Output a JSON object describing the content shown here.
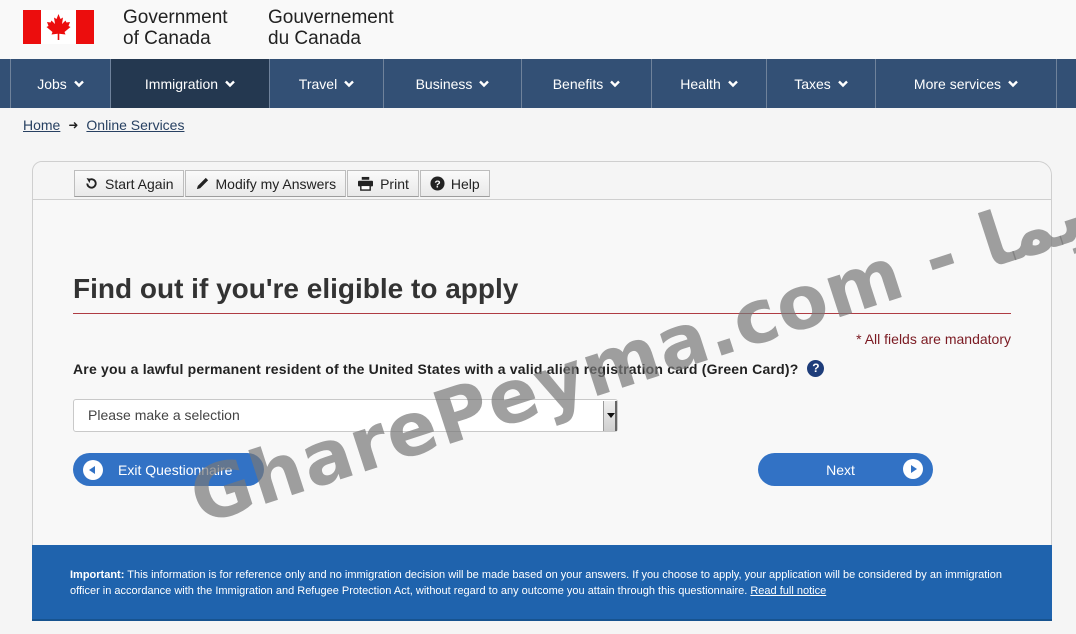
{
  "header": {
    "signature_en_line1": "Government",
    "signature_en_line2": "of Canada",
    "signature_fr_line1": "Gouvernement",
    "signature_fr_line2": "du Canada",
    "flag_icon": "canada-flag-icon"
  },
  "nav": {
    "items": [
      {
        "label": "Jobs",
        "active": false
      },
      {
        "label": "Immigration",
        "active": true
      },
      {
        "label": "Travel",
        "active": false
      },
      {
        "label": "Business",
        "active": false
      },
      {
        "label": "Benefits",
        "active": false
      },
      {
        "label": "Health",
        "active": false
      },
      {
        "label": "Taxes",
        "active": false
      },
      {
        "label": "More services",
        "active": false
      }
    ]
  },
  "breadcrumb": {
    "items": [
      "Home",
      "Online Services"
    ],
    "separator_icon": "arrow-right-icon"
  },
  "toolbar": {
    "start_again": "Start Again",
    "modify_answers": "Modify my Answers",
    "print": "Print",
    "help": "Help"
  },
  "main": {
    "title": "Find out if you're eligible to apply",
    "mandatory_note": "* All fields are mandatory",
    "question": "Are you a lawful permanent resident of the United States with a valid alien registration card (Green Card)?",
    "help_glyph": "?",
    "select_value": "Please make a selection",
    "exit_label": "Exit Questionnaire",
    "next_label": "Next"
  },
  "notice": {
    "label": "Important:",
    "text": " This information is for reference only and no immigration decision will be made based on your answers. If you choose to apply, your application will be considered by an immigration officer in accordance with the Immigration and Refugee Protection Act, without regard to any outcome you attain through this questionnaire. ",
    "link": "Read full notice"
  },
  "watermark": {
    "text": "GharePeyma.com - قاره پیما"
  },
  "colors": {
    "nav_bg": "#335075",
    "nav_active": "#243850",
    "pill_blue": "#3272c5",
    "notice_blue": "#1f63ad",
    "rule_red": "#af3c43",
    "flag_red": "#ec0d0d"
  }
}
